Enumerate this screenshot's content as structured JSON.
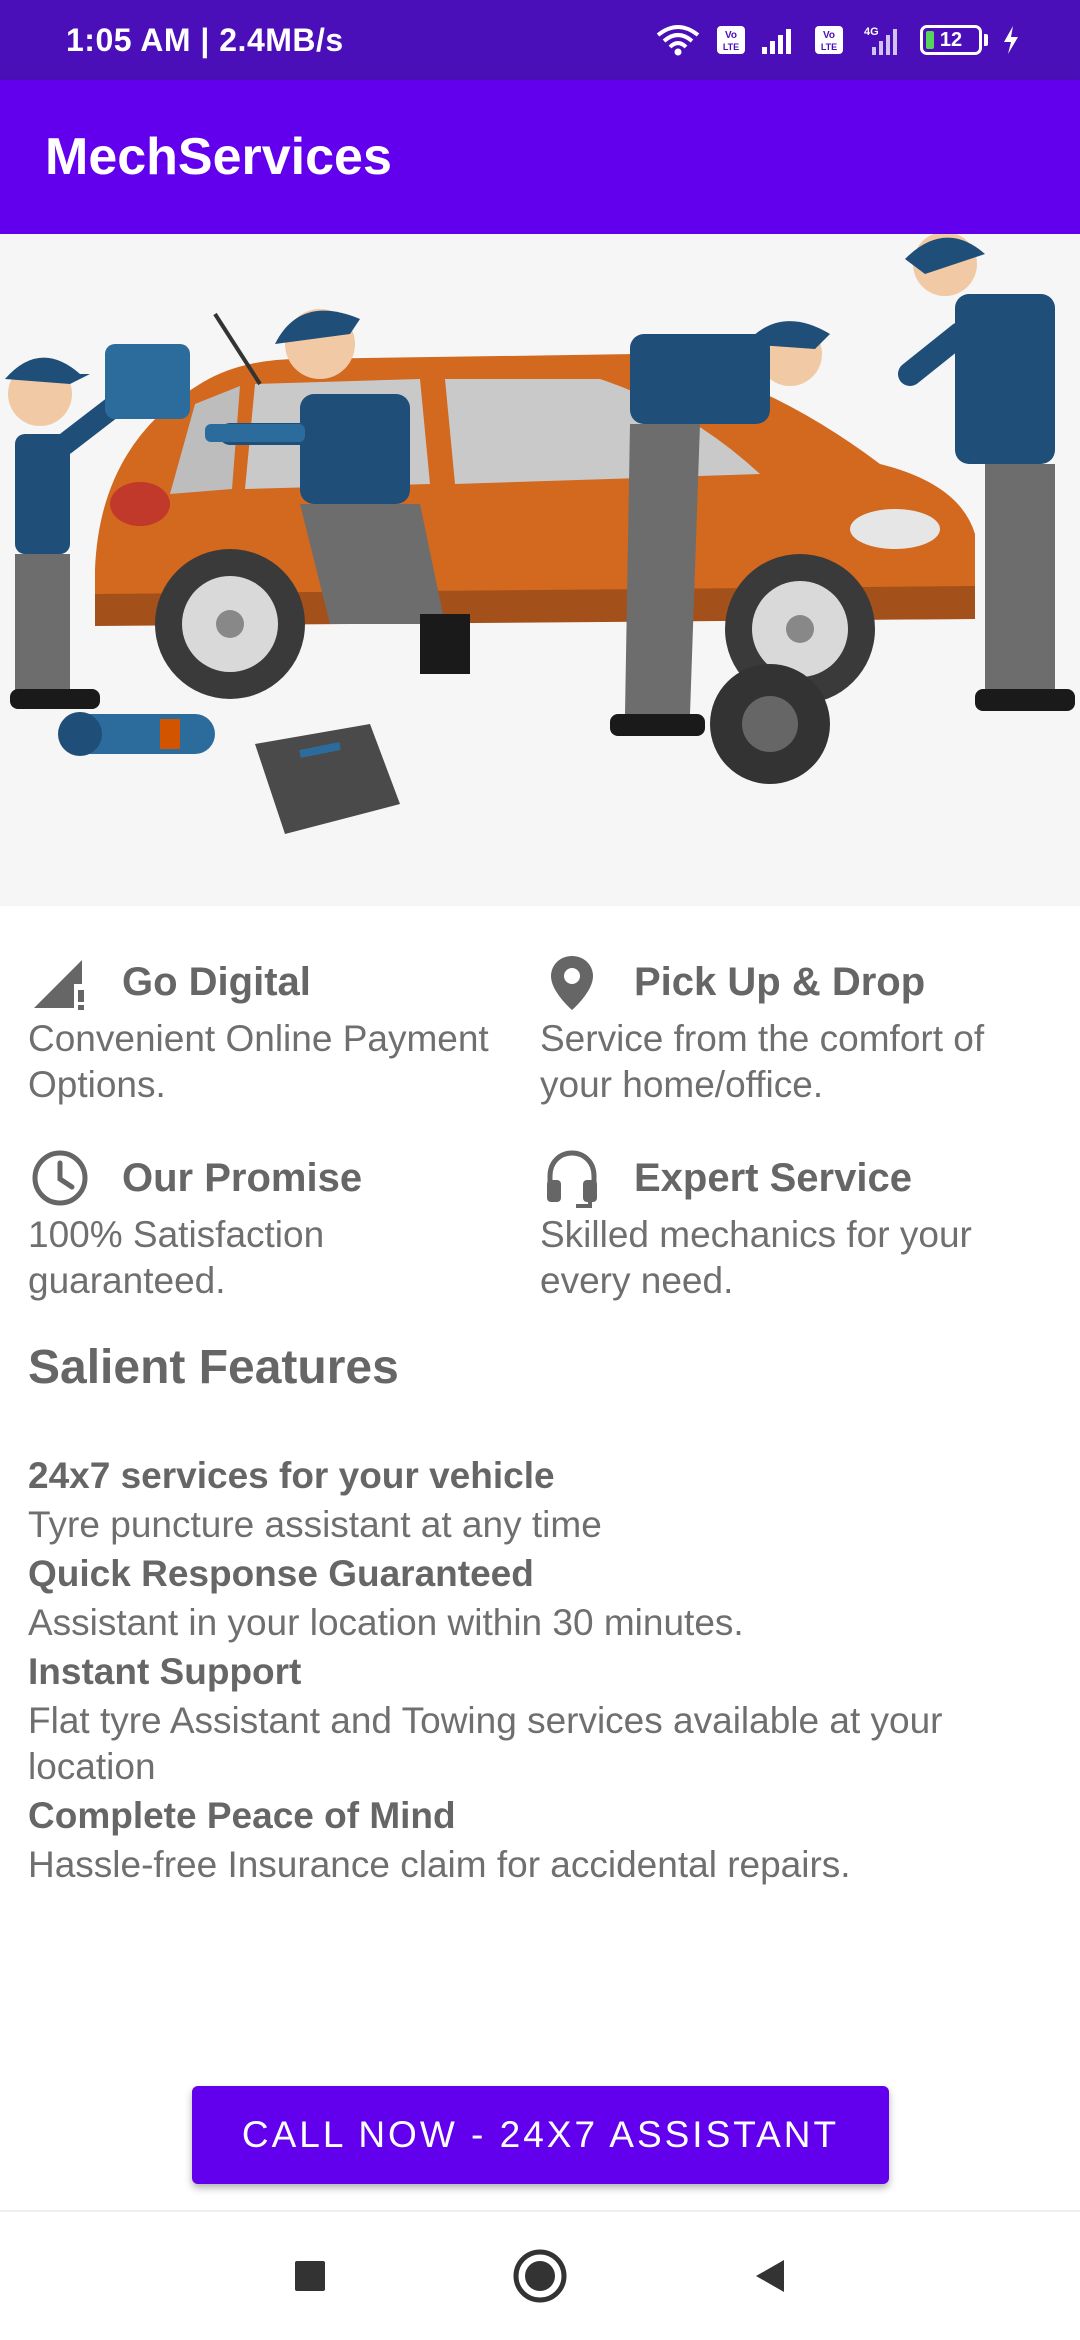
{
  "status_bar": {
    "time_speed": "1:05 AM | 2.4MB/s",
    "battery_level": "12",
    "network_labels": {
      "volte1": "Vo LTE",
      "volte2": "Vo LTE",
      "net": "4G"
    }
  },
  "app_bar": {
    "title": "MechServices"
  },
  "hero": {
    "icon": "mechanics-car-illustration"
  },
  "features": [
    {
      "icon": "signal-icon",
      "title": "Go Digital",
      "desc": "Convenient Online Payment Options."
    },
    {
      "icon": "location-pin-icon",
      "title": "Pick Up & Drop",
      "desc": "Service from the comfort of your home/office."
    },
    {
      "icon": "clock-icon",
      "title": "Our Promise",
      "desc": "100% Satisfaction guaranteed."
    },
    {
      "icon": "headset-icon",
      "title": "Expert Service",
      "desc": "Skilled mechanics for your every need."
    }
  ],
  "salient": {
    "title": "Salient Features",
    "items": [
      {
        "head": "24x7 services for your vehicle",
        "desc": "Tyre puncture assistant at any time"
      },
      {
        "head": "Quick Response Guaranteed",
        "desc": "Assistant in your location within 30 minutes."
      },
      {
        "head": "Instant Support",
        "desc": "Flat tyre Assistant and Towing services available at your location"
      },
      {
        "head": "Complete Peace of Mind",
        "desc": "Hassle-free Insurance claim for accidental repairs."
      }
    ]
  },
  "cta": {
    "label": "CALL NOW - 24X7 ASSISTANT"
  },
  "nav": {
    "recents_icon": "square-icon",
    "home_icon": "circle-icon",
    "back_icon": "triangle-back-icon"
  },
  "colors": {
    "status_bar": "#4a0fb8",
    "primary": "#6200ee",
    "text_gray": "#666666"
  }
}
